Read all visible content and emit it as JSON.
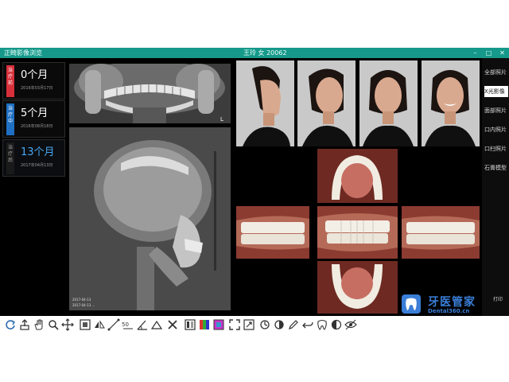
{
  "titlebar": {
    "app_title": "正畸影像浏览",
    "patient": "王玲 女 20062",
    "min_icon": "minimize-icon",
    "restore_icon": "restore-icon",
    "close_icon": "close-icon"
  },
  "timeline": [
    {
      "tag": "治疗前",
      "months": "0个月",
      "date": "2016年03月17日",
      "tag_color": "#d6303a",
      "selected": false
    },
    {
      "tag": "治疗中",
      "months": "5个月",
      "date": "2016年08月18日",
      "tag_color": "#1f6fc2",
      "selected": false
    },
    {
      "tag": "治疗后",
      "months": "13个月",
      "date": "2017年04月13日",
      "tag_color": "#1a1a1a",
      "selected": true
    }
  ],
  "xrays": {
    "ceph_caption_1": "2017-04-13",
    "ceph_caption_2": "2017-04-13 ..."
  },
  "sidebar": {
    "items": [
      "全部照片",
      "X光影像",
      "面部照片",
      "口内照片",
      "口扫照片",
      "石膏模型"
    ],
    "active_index": 1
  },
  "watermark": {
    "text_cn": "牙医管家",
    "url": "Dental360.cn",
    "print_label": "打印"
  },
  "colors": {
    "titlebar": "#16998a",
    "accent": "#49a8f3",
    "watermark": "#3a7ed8"
  },
  "toolbar": {
    "tools": [
      "rotate-icon",
      "upload-icon",
      "hand-icon",
      "magnify-icon",
      "move-icon",
      "crop-icon",
      "flip-icon",
      "measure-icon",
      "angle-icon",
      "ruler-icon",
      "protractor-icon",
      "delete-icon",
      "compare-icon",
      "color-icon",
      "palette-icon",
      "fullscreen-icon",
      "resize-icon",
      "reset-icon",
      "brightness-icon",
      "pen-icon",
      "undo-icon",
      "tooth-icon",
      "contrast-icon",
      "eye-icon"
    ]
  }
}
